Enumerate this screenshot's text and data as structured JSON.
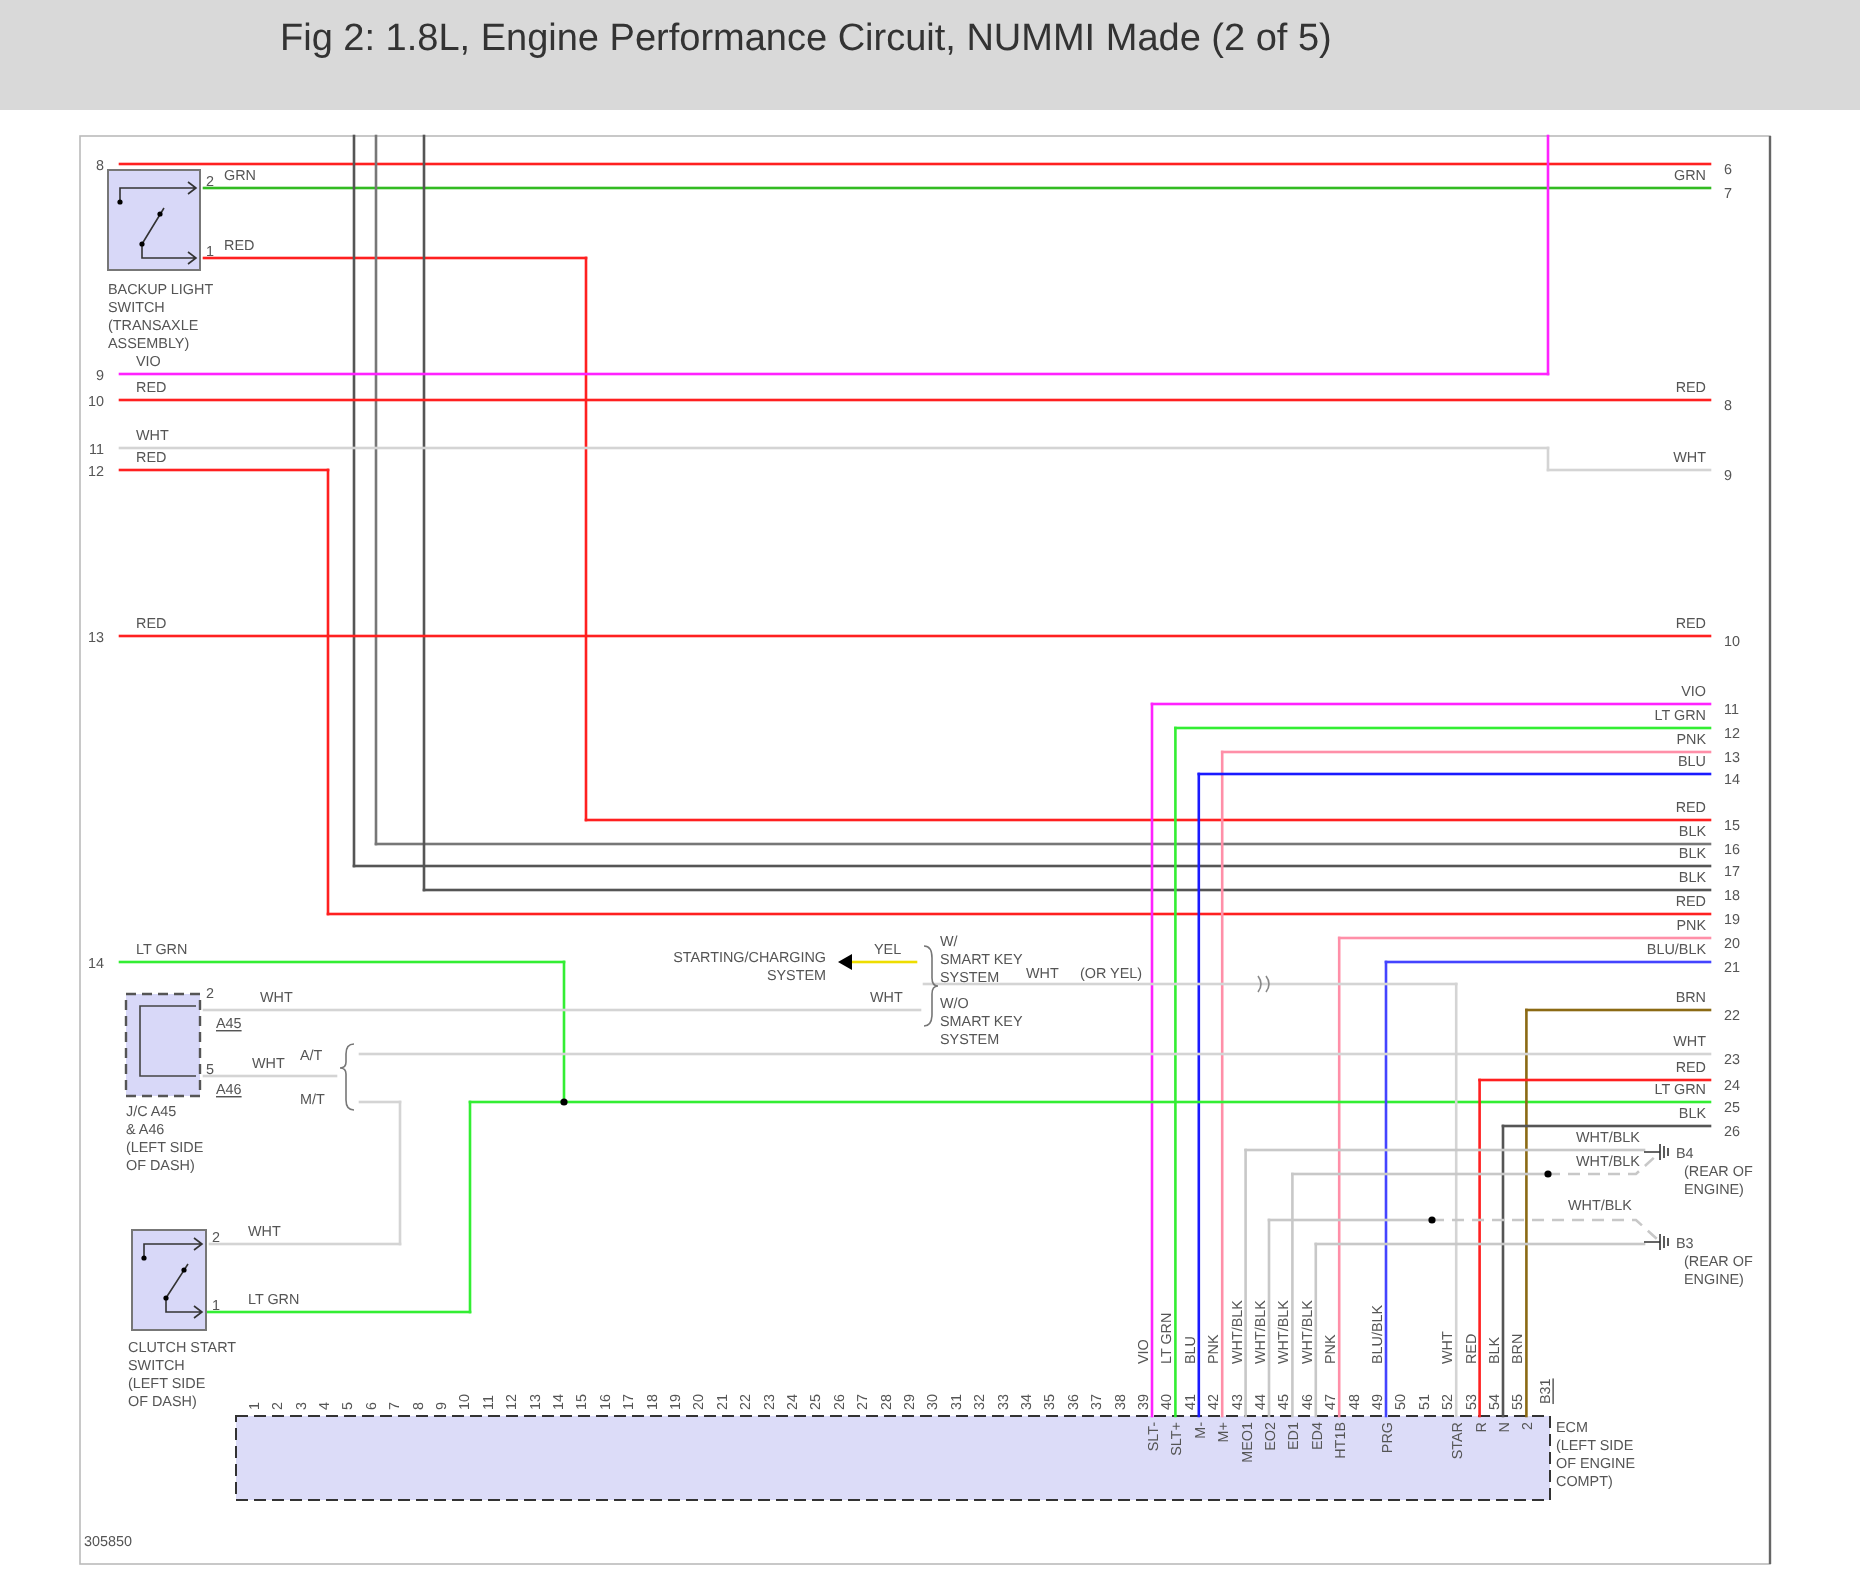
{
  "header": {
    "title": "Fig 2: 1.8L, Engine Performance Circuit, NUMMI Made (2 of 5)"
  },
  "diagram": {
    "left_terminals": [
      "8",
      "9",
      "10",
      "11",
      "12",
      "13",
      "14"
    ],
    "right_terminals": [
      "6",
      "7",
      "8",
      "9",
      "10",
      "11",
      "12",
      "13",
      "14",
      "15",
      "16",
      "17",
      "18",
      "19",
      "20",
      "21",
      "22",
      "23",
      "24",
      "25",
      "26"
    ],
    "wires": [
      {
        "color": "#ff2020"
      },
      {
        "color": "#33bb22",
        "labels": [
          "GRN",
          "GRN"
        ]
      },
      {
        "color": "#ff2020",
        "labels": [
          "RED",
          "RED"
        ]
      },
      {
        "color": "#777777",
        "labels": [
          "BLK"
        ]
      },
      {
        "color": "#555555",
        "labels": [
          "BLK"
        ]
      },
      {
        "color": "#555555",
        "labels": [
          "BLK"
        ]
      },
      {
        "color": "#ff22ff",
        "labels": [
          "VIO"
        ]
      },
      {
        "color": "#ff2020",
        "labels": [
          "RED",
          "RED"
        ]
      },
      {
        "color": "#d4d4d4",
        "labels": [
          "WHT",
          "WHT"
        ]
      },
      {
        "color": "#ff2020",
        "labels": [
          "RED",
          "RED"
        ]
      },
      {
        "color": "#ff2020",
        "labels": [
          "RED",
          "RED"
        ]
      },
      {
        "color": "#ff22ff",
        "labels": [
          "VIO",
          "VIO"
        ]
      },
      {
        "color": "#33ee33",
        "labels": [
          "LT GRN",
          "LT GRN"
        ]
      },
      {
        "color": "#ff8fa8",
        "labels": [
          "PNK",
          "PNK"
        ]
      },
      {
        "color": "#1a1aff",
        "labels": [
          "BLU",
          "BLU"
        ]
      },
      {
        "color": "#ff8fa8",
        "labels": [
          "PNK",
          "PNK"
        ]
      },
      {
        "color": "#33ee33",
        "labels": [
          "LT GRN",
          "LT GRN"
        ]
      },
      {
        "color": "#eedd00",
        "labels": [
          "YEL"
        ]
      },
      {
        "color": "#4444ff",
        "labels": [
          "BLU/BLK",
          "BLU/BLK"
        ]
      },
      {
        "color": "#d4d4d4",
        "labels": [
          "WHT",
          "WHT",
          "(OR YEL)"
        ]
      },
      {
        "color": "#d4d4d4",
        "labels": [
          "WHT",
          "WHT"
        ]
      },
      {
        "color": "#8b6a14",
        "labels": [
          "BRN",
          "BRN"
        ]
      },
      {
        "color": "#d4d4d4",
        "labels": [
          "WHT"
        ]
      },
      {
        "color": "#d4d4d4",
        "labels": [
          "WHT"
        ]
      },
      {
        "color": "#ff2020",
        "labels": [
          "RED",
          "RED"
        ]
      },
      {
        "color": "#d4d4d4",
        "labels": [
          "WHT"
        ]
      },
      {
        "color": "#33ee33",
        "labels": [
          "LT GRN"
        ]
      },
      {
        "color": "#555555",
        "labels": [
          "BLK",
          "BLK"
        ]
      },
      {
        "color": "#c8c8c8",
        "labels": [
          "WHT/BLK",
          "WHT/BLK"
        ]
      },
      {
        "color": "#c8c8c8",
        "labels": [
          "WHT/BLK",
          "WHT/BLK"
        ]
      },
      {
        "color": "#c8c8c8",
        "labels": [
          "WHT/BLK",
          "WHT/BLK"
        ]
      },
      {
        "color": "#c8c8c8",
        "labels": [
          "WHT/BLK"
        ]
      }
    ],
    "components": [
      {
        "kind": "switch",
        "pins": [
          "2",
          "1"
        ],
        "caption": [
          "BACKUP LIGHT",
          "SWITCH",
          "(TRANSAXLE",
          "ASSEMBLY)"
        ]
      },
      {
        "kind": "junction",
        "pins": [
          "2",
          "5"
        ],
        "connectors": [
          "A45",
          "A46"
        ],
        "caption": [
          "J/C A45",
          "& A46",
          "(LEFT SIDE",
          "OF DASH)"
        ]
      },
      {
        "kind": "switch",
        "pins": [
          "2",
          "1"
        ],
        "caption": [
          "CLUTCH START",
          "SWITCH",
          "(LEFT SIDE",
          "OF DASH)"
        ]
      }
    ],
    "transmission_labels": [
      "A/T",
      "M/T"
    ],
    "starting_charging": [
      "STARTING/CHARGING",
      "SYSTEM"
    ],
    "smart_key_options": [
      [
        "W/",
        "SMART KEY",
        "SYSTEM"
      ],
      [
        "W/O",
        "SMART KEY",
        "SYSTEM"
      ]
    ],
    "grounds": [
      {
        "name": "B4",
        "caption": [
          "(REAR OF",
          "ENGINE)"
        ]
      },
      {
        "name": "B3",
        "caption": [
          "(REAR OF",
          "ENGINE)"
        ]
      }
    ],
    "ecm": {
      "pins": [
        "1",
        "2",
        "3",
        "4",
        "5",
        "6",
        "7",
        "8",
        "9",
        "10",
        "11",
        "12",
        "13",
        "14",
        "15",
        "16",
        "17",
        "18",
        "19",
        "20",
        "21",
        "22",
        "23",
        "24",
        "25",
        "26",
        "27",
        "28",
        "29",
        "30",
        "31",
        "32",
        "33",
        "34",
        "35",
        "36",
        "37",
        "38",
        "39",
        "40",
        "41",
        "42",
        "43",
        "44",
        "45",
        "46",
        "47",
        "48",
        "49",
        "50",
        "51",
        "52",
        "53",
        "54",
        "55"
      ],
      "connector": "B31",
      "terminals": [
        "SLT-",
        "SLT+",
        "M-",
        "M+",
        "MEO1",
        "EO2",
        "ED1",
        "ED4",
        "HT1B",
        "PRG",
        "STAR",
        "R",
        "N",
        "2"
      ],
      "caption": [
        "ECM",
        "(LEFT SIDE",
        "OF ENGINE",
        "COMPT)"
      ]
    },
    "figure_number": "305850"
  }
}
